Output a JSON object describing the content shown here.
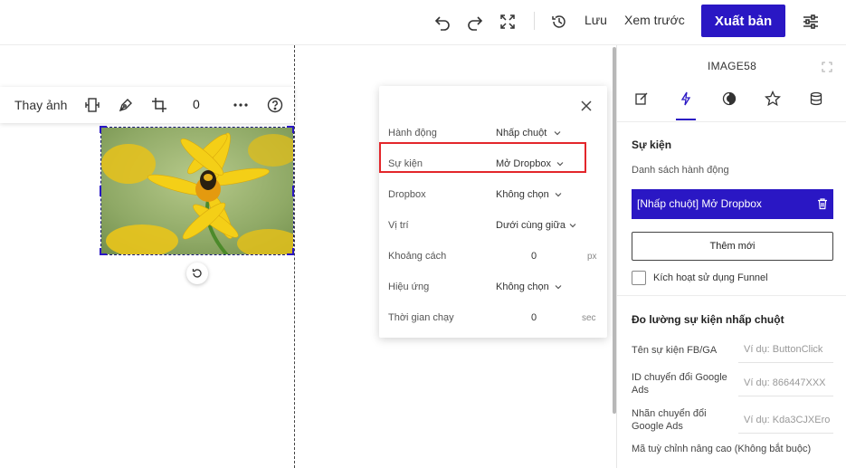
{
  "topbar": {
    "save_label": "Lưu",
    "preview_label": "Xem trước",
    "publish_label": "Xuất bản",
    "icons": [
      "undo-icon",
      "redo-icon",
      "fullscreen-icon",
      "history-icon",
      "settings-sliders-icon"
    ]
  },
  "image_toolbar": {
    "replace_label": "Thay ảnh",
    "rotation_value": "0",
    "icons": [
      "resize-icon",
      "pen-icon",
      "crop-icon",
      "more-icon",
      "help-icon"
    ]
  },
  "popup": {
    "rows": [
      {
        "label": "Hành động",
        "value": "Nhấp chuột"
      },
      {
        "label": "Sự kiện",
        "value": "Mở Dropbox"
      },
      {
        "label": "Dropbox",
        "value": "Không chọn"
      },
      {
        "label": "Vị trí",
        "value": "Dưới cùng giữa"
      },
      {
        "label": "Khoảng cách",
        "value": "0",
        "unit": "px"
      },
      {
        "label": "Hiệu ứng",
        "value": "Không chọn"
      },
      {
        "label": "Thời gian chạy",
        "value": "0",
        "unit": "sec"
      }
    ]
  },
  "panel": {
    "title": "IMAGE58",
    "tabs": [
      "edit-icon",
      "lightning-icon",
      "style-icon",
      "star-icon",
      "database-icon"
    ],
    "active_tab": 1,
    "events_title": "Sự kiện",
    "action_list_label": "Danh sách hành động",
    "action_item": "[Nhấp chuột] Mở Dropbox",
    "add_button": "Thêm mới",
    "funnel_label": "Kích hoạt sử dụng Funnel",
    "tracking_title": "Đo lường sự kiện nhấp chuột",
    "fields": [
      {
        "label": "Tên sự kiện FB/GA",
        "placeholder": "Ví dụ: ButtonClick"
      },
      {
        "label": "ID chuyển đổi Google Ads",
        "placeholder": "Ví dụ: 866447XXX"
      },
      {
        "label": "Nhãn chuyển đổi Google Ads",
        "placeholder": "Ví dụ: Kda3CJXEro"
      }
    ],
    "custom_code_label": "Mã tuỳ chỉnh nâng cao (Không bắt buộc)"
  },
  "colors": {
    "accent": "#2a17c4",
    "highlight": "#e3262b"
  }
}
